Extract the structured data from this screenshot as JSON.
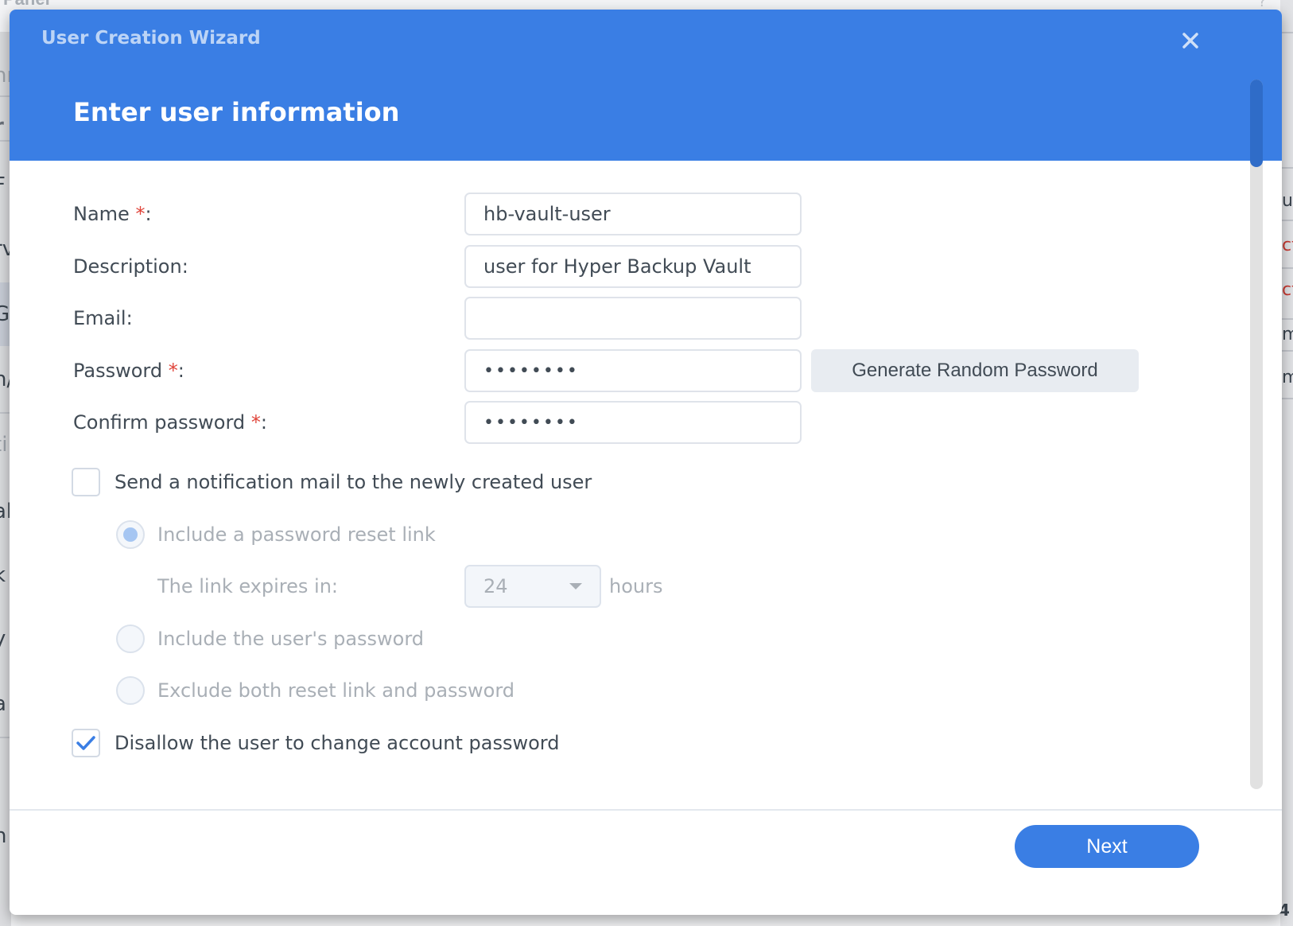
{
  "background": {
    "title_fragment": "Panel",
    "help_fragment": "?",
    "left_fragments": [
      "hr",
      "r",
      "F",
      "rv",
      "G",
      "n/",
      "ti",
      "al",
      "k",
      "y",
      "a",
      "n"
    ],
    "right_fragments": [
      "u",
      "ct",
      "ct",
      "m",
      "m"
    ],
    "bottom_right_fragment": "4"
  },
  "dialog": {
    "wizard_title": "User Creation Wizard",
    "step_title": "Enter user information",
    "close_icon": "close-icon",
    "accent_color": "#3a7ee4"
  },
  "form": {
    "name": {
      "label": "Name",
      "required_mark": "*",
      "colon": ":",
      "value": "hb-vault-user"
    },
    "description": {
      "label": "Description:",
      "value": "user for Hyper Backup Vault"
    },
    "email": {
      "label": "Email:",
      "value": ""
    },
    "password": {
      "label": "Password",
      "required_mark": "*",
      "colon": ":",
      "value": "••••••••"
    },
    "confirm_password": {
      "label": "Confirm password",
      "required_mark": "*",
      "colon": ":",
      "value": "••••••••"
    },
    "generate_password_button": "Generate Random Password",
    "send_notification": {
      "label": "Send a notification mail to the newly created user",
      "checked": false
    },
    "notification_options": [
      {
        "label": "Include a password reset link",
        "selected": true,
        "disabled": true
      },
      {
        "label": "Include the user's password",
        "selected": false,
        "disabled": true
      },
      {
        "label": "Exclude both reset link and password",
        "selected": false,
        "disabled": true
      }
    ],
    "link_expires": {
      "label": "The link expires in:",
      "value": "24",
      "unit": "hours"
    },
    "disallow_change_password": {
      "label": "Disallow the user to change account password",
      "checked": true
    }
  },
  "footer": {
    "next_button": "Next"
  }
}
